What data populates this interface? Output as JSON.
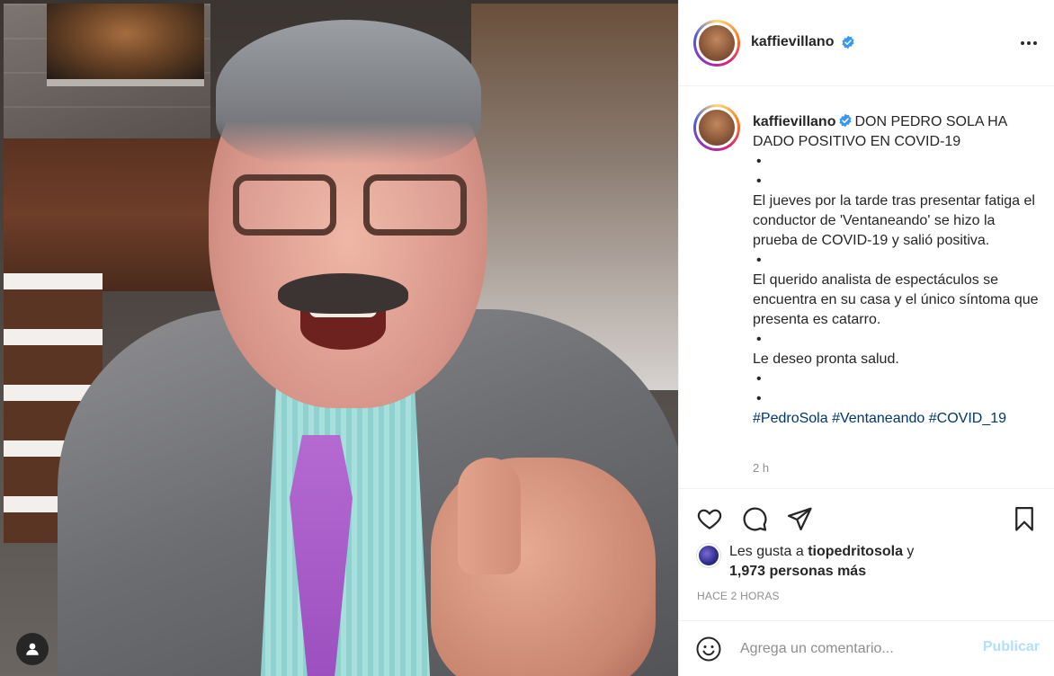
{
  "post": {
    "username": "kaffievillano",
    "more_icon": "more-horizontal-icon",
    "verified_icon": "verified-badge-icon"
  },
  "caption": {
    "username": "kaffievillano",
    "headline": "DON PEDRO SOLA HA DADO POSITIVO EN COVID-19",
    "dot": "•",
    "paragraph1": "El jueves por la tarde tras presentar fatiga el conductor de 'Ventaneando' se hizo la prueba de COVID-19 y salió positiva.",
    "paragraph2": "El querido analista de espectáculos se encuentra en su casa y el único síntoma que presenta es catarro.",
    "paragraph3": "Le deseo pronta salud.",
    "hashtags": [
      "#PedroSola",
      "#Ventaneando",
      "#COVID_19"
    ],
    "time": "2 h"
  },
  "actions": {
    "like_icon": "heart-icon",
    "comment_icon": "comment-icon",
    "share_icon": "share-icon",
    "save_icon": "bookmark-icon"
  },
  "likes": {
    "prefix": "Les gusta a",
    "user": "tiopedritosola",
    "connector": "y",
    "count_text": "1,973 personas más"
  },
  "posted_ago": "HACE 2 HORAS",
  "comment": {
    "placeholder": "Agrega un comentario...",
    "publish_label": "Publicar",
    "emoji_icon": "smiley-icon"
  },
  "media": {
    "user_tag_icon": "user-tag-icon"
  },
  "colors": {
    "link": "#00376b",
    "verified": "#3897f0",
    "publish_disabled": "#b2dffc",
    "muted": "#8e8e8e"
  }
}
